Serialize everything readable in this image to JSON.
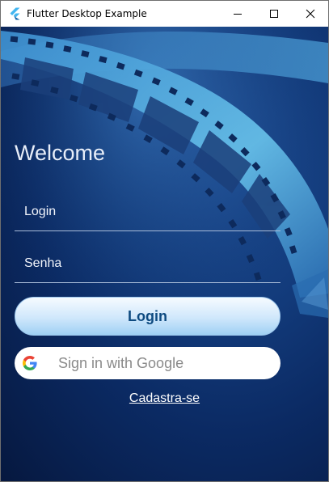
{
  "window": {
    "title": "Flutter Desktop Example",
    "app_icon": "flutter-logo-icon",
    "controls": [
      "minimize-icon",
      "maximize-icon",
      "close-icon"
    ]
  },
  "login_screen": {
    "welcome": "Welcome",
    "login_placeholder": "Login",
    "login_value": "",
    "password_placeholder": "Senha",
    "password_value": "",
    "login_button": "Login",
    "google_button": "Sign in with Google",
    "google_icon": "google-logo-icon",
    "signup_link": "Cadastra-se",
    "background": "film-strip-image"
  },
  "colors": {
    "background_deep": "#0b2a63",
    "film_strip": "#5fb3e3",
    "login_button_text": "#0d4a80",
    "google_text": "#8a8a8a"
  }
}
